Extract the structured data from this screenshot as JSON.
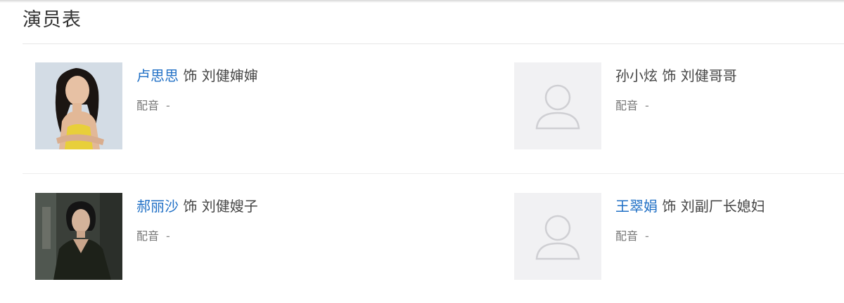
{
  "section": {
    "title": "演员表"
  },
  "cast": [
    {
      "actor": "卢思思",
      "as": "饰",
      "role": "刘健婶婶",
      "dub_label": "配音",
      "dub_value": "-",
      "avatar": "photo-woman-yellow-top"
    },
    {
      "actor": "孙小炫",
      "as": "饰",
      "role": "刘健哥哥",
      "dub_label": "配音",
      "dub_value": "-",
      "avatar": "user-placeholder-icon"
    },
    {
      "actor": "郝丽沙",
      "as": "饰",
      "role": "刘健嫂子",
      "dub_label": "配音",
      "dub_value": "-",
      "avatar": "photo-woman-dark-outfit"
    },
    {
      "actor": "王翠娟",
      "as": "饰",
      "role": "刘副厂长媳妇",
      "dub_label": "配音",
      "dub_value": "-",
      "avatar": "user-placeholder-icon"
    }
  ],
  "colors": {
    "link": "#1f6fc5",
    "text": "#444444",
    "muted": "#777777",
    "placeholder_bg": "#f1f1f3"
  }
}
